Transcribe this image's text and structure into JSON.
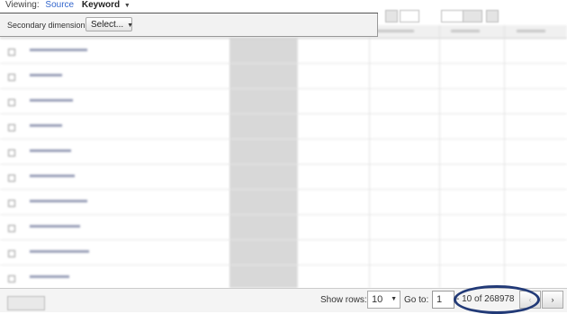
{
  "viewing": {
    "label": "Viewing:",
    "options": {
      "source": "Source",
      "keyword": "Keyword"
    }
  },
  "secondary": {
    "label": "Secondary dimension:",
    "select_label": "Select..."
  },
  "footer": {
    "show_rows_label": "Show rows:",
    "rows_value": "10",
    "goto_label": "Go to:",
    "page_value": "1",
    "range_text": "- 10 of 268978",
    "next_label": "›",
    "prev_label": "‹"
  },
  "annotation": {
    "color": "#223a77"
  },
  "colors": {
    "link": "#3366cc",
    "visits_shade": "#d8d8d8"
  }
}
